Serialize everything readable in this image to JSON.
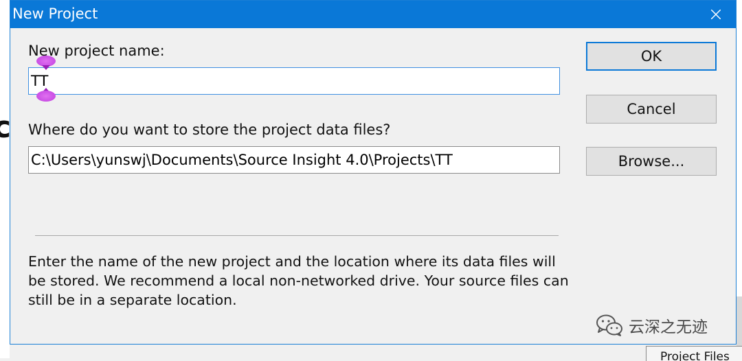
{
  "dialog": {
    "title": "New Project",
    "close_icon": "close-icon"
  },
  "form": {
    "name_label": "New project name:",
    "name_value": "TT",
    "location_label": "Where do you want to store the project data files?",
    "location_value": "C:\\Users\\yunswj\\Documents\\Source Insight 4.0\\Projects\\TT"
  },
  "buttons": {
    "ok": "OK",
    "cancel": "Cancel",
    "browse": "Browse..."
  },
  "help_text": "Enter the name of the new project and the location where its data files will be stored. We recommend a local non-networked drive. Your source files can still be in a separate location.",
  "background": {
    "left_glyph": "c",
    "bottom_tab": "Project Files"
  },
  "watermark": {
    "text": "云深之无迹",
    "icon": "wechat-icon"
  },
  "colors": {
    "titlebar": "#0a78d7",
    "caret_handle": "#d060f0"
  }
}
